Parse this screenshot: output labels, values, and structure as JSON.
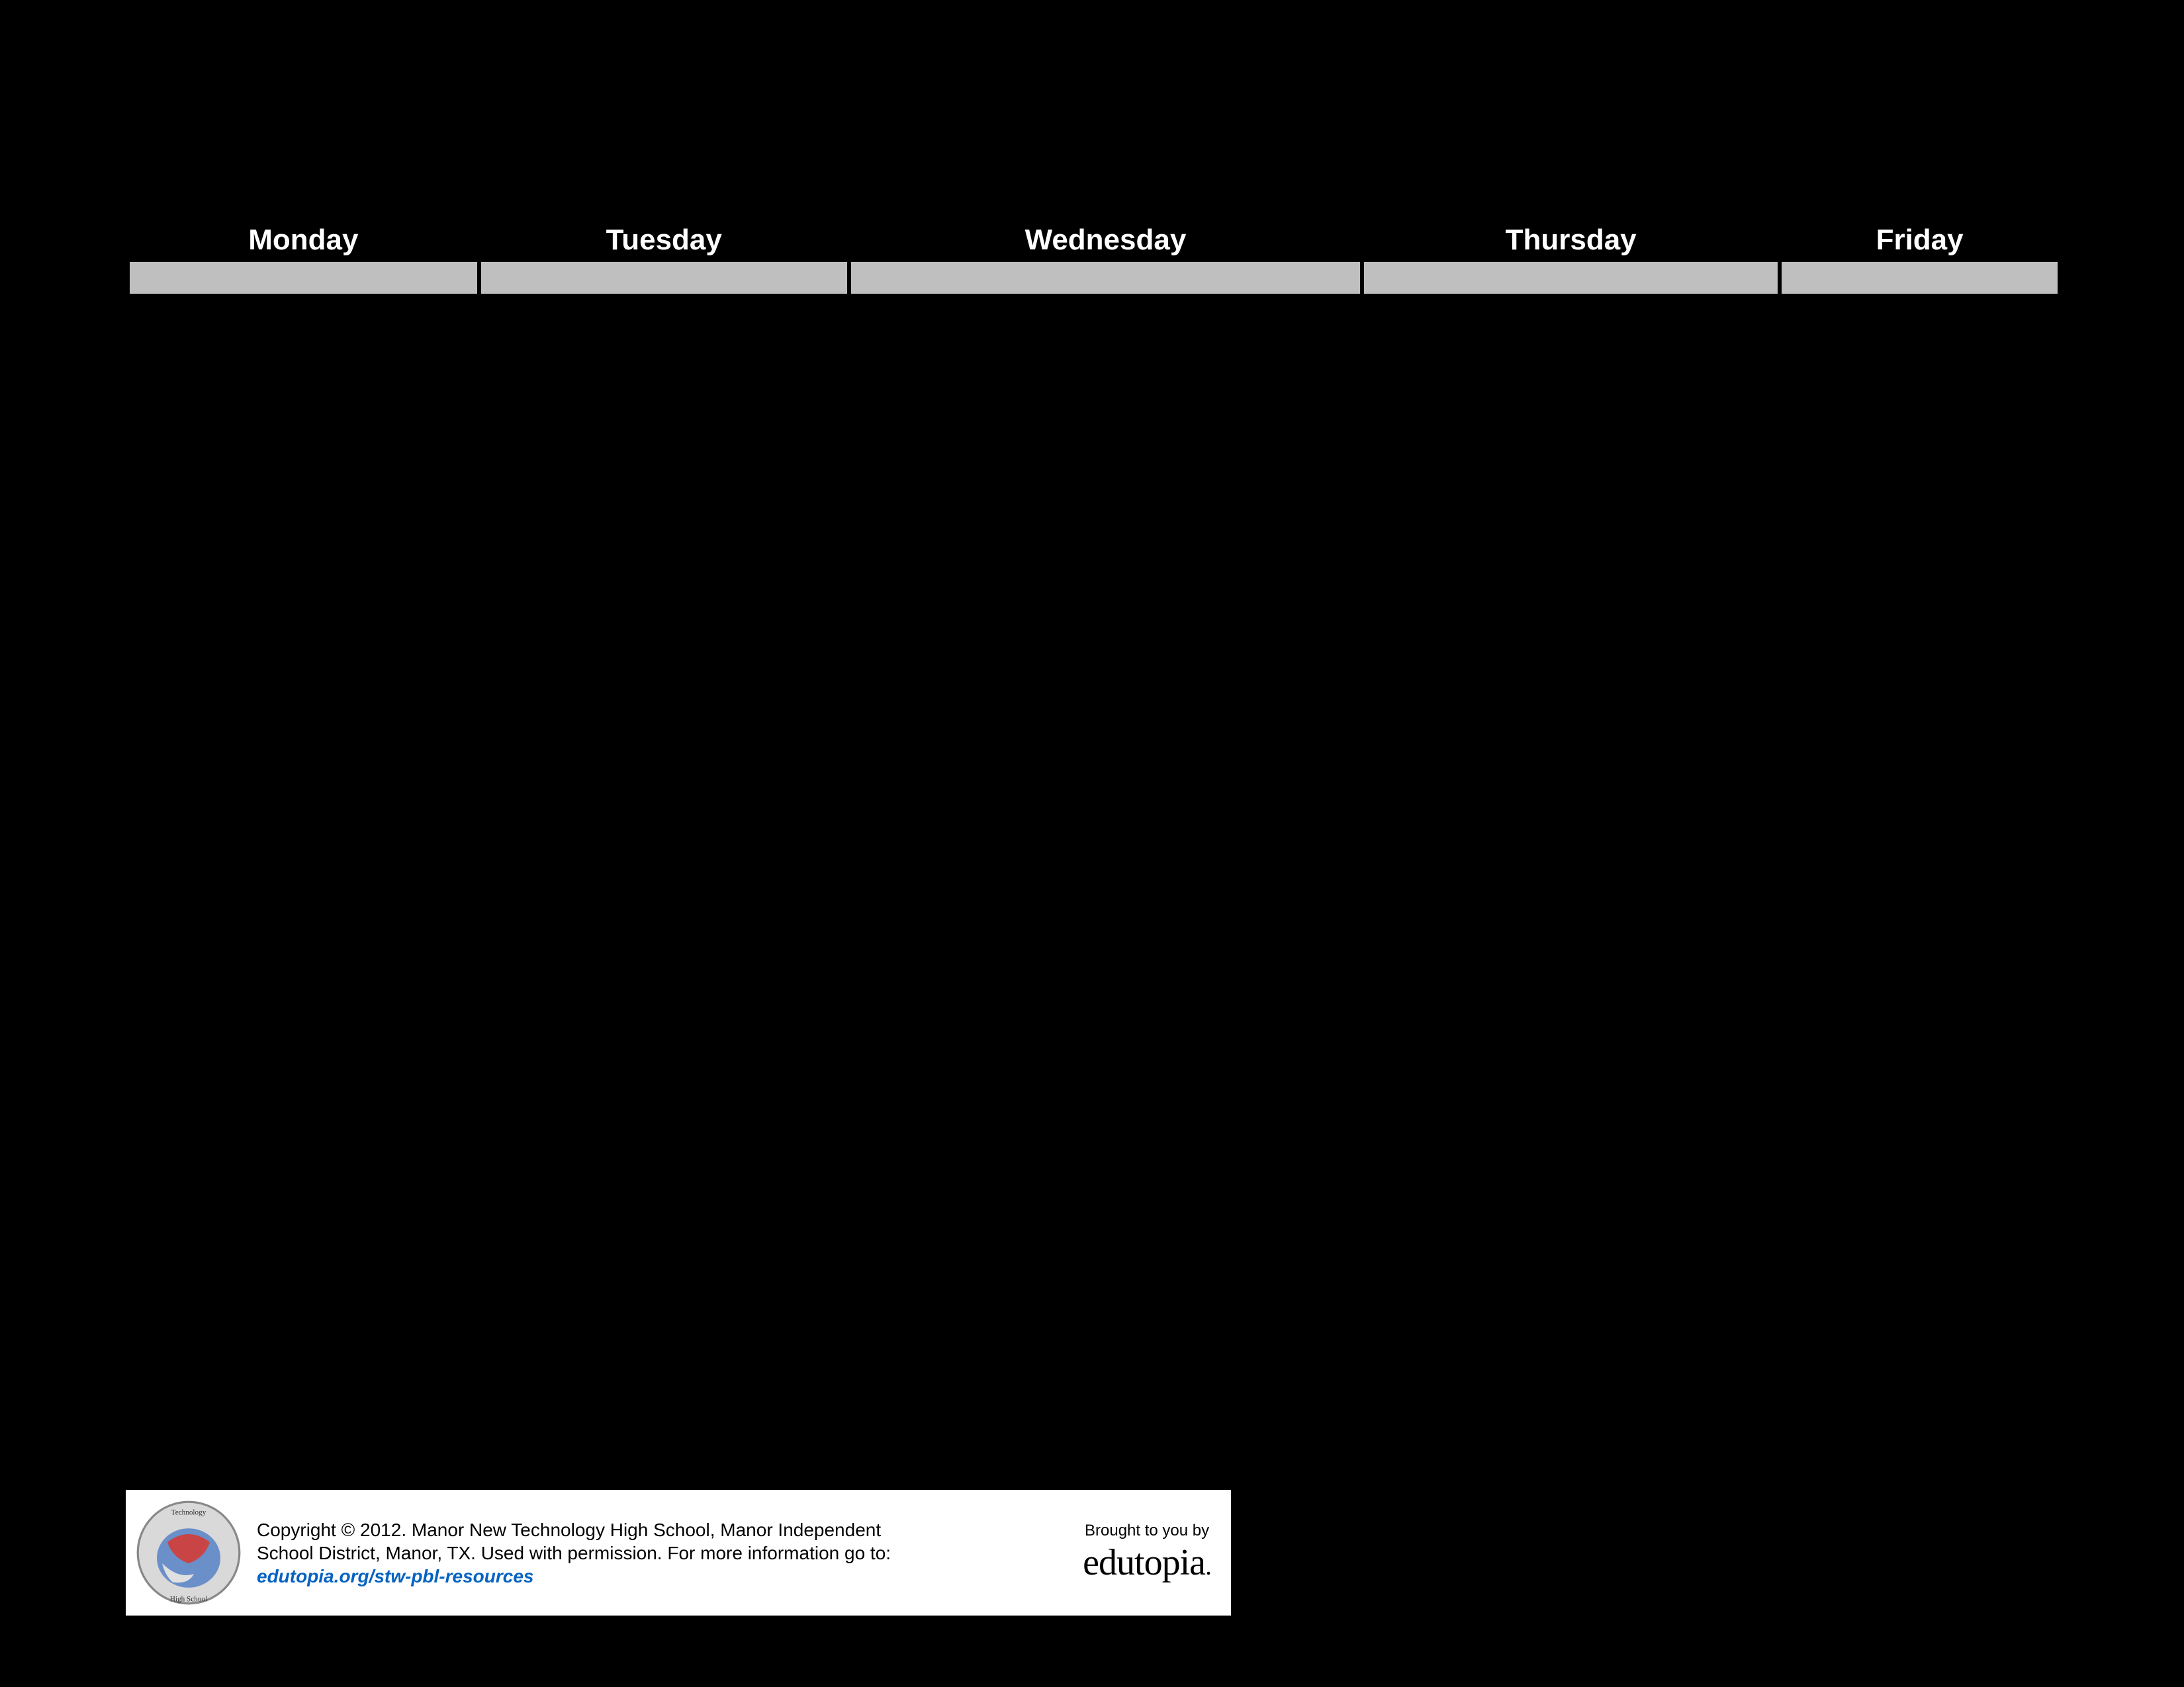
{
  "calendar": {
    "days": [
      "Monday",
      "Tuesday",
      "Wednesday",
      "Thursday",
      "Friday"
    ]
  },
  "footer": {
    "copyright_line1": "Copyright © 2012. Manor New Technology High School, Manor Independent",
    "copyright_line2": "School District, Manor, TX. Used with permission. For more information go to:",
    "link": "edutopia.org/stw-pbl-resources",
    "brought_by": "Brought to you by",
    "brand": "edutopia"
  }
}
